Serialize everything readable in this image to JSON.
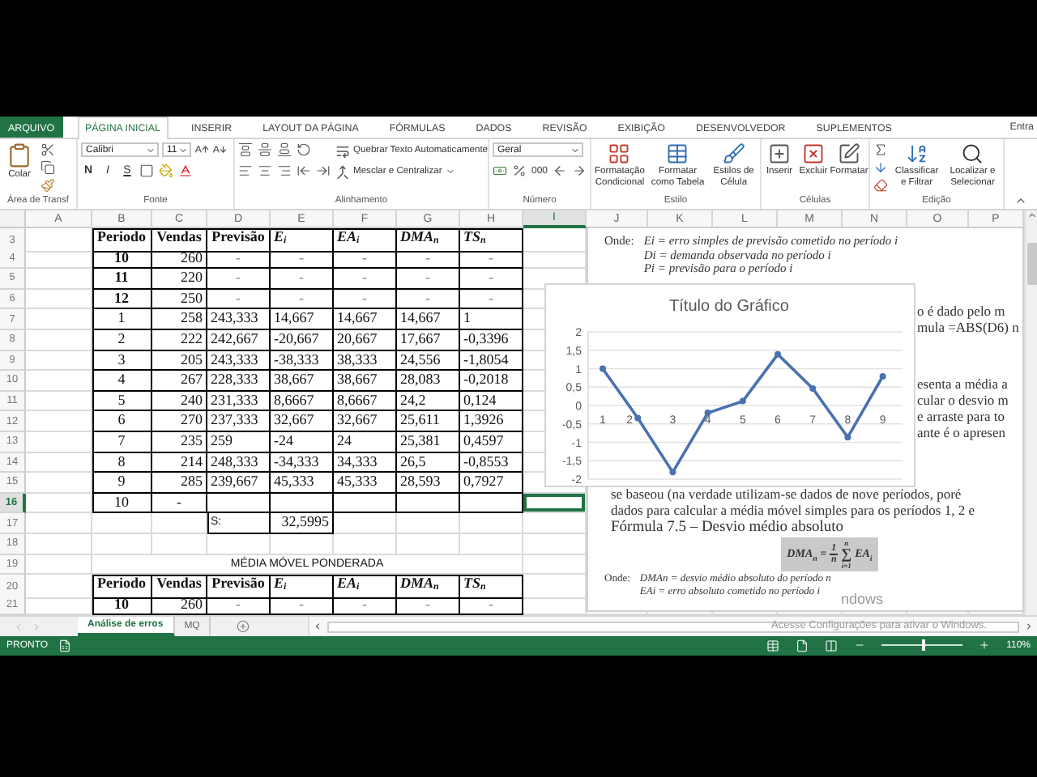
{
  "ribbon": {
    "tabs": [
      {
        "label": "ARQUIVO",
        "kind": "file",
        "selected": false
      },
      {
        "label": "PÁGINA INICIAL",
        "kind": "tab",
        "selected": true
      },
      {
        "label": "INSERIR",
        "kind": "tab",
        "selected": false
      },
      {
        "label": "LAYOUT DA PÁGINA",
        "kind": "tab",
        "selected": false
      },
      {
        "label": "FÓRMULAS",
        "kind": "tab",
        "selected": false
      },
      {
        "label": "DADOS",
        "kind": "tab",
        "selected": false
      },
      {
        "label": "REVISÃO",
        "kind": "tab",
        "selected": false
      },
      {
        "label": "EXIBIÇÃO",
        "kind": "tab",
        "selected": false
      },
      {
        "label": "DESENVOLVEDOR",
        "kind": "tab",
        "selected": false
      },
      {
        "label": "SUPLEMENTOS",
        "kind": "tab",
        "selected": false
      }
    ],
    "account": "Entra",
    "groups": [
      {
        "kind": "clipboard",
        "label": "Área de Transf",
        "buttons": [
          "Colar"
        ]
      },
      {
        "kind": "font",
        "label": "Fonte",
        "font": "Calibri",
        "size": "11",
        "styles": [
          "N",
          "I",
          "S"
        ]
      },
      {
        "kind": "alignment",
        "label": "Alinhamento",
        "buttons": [
          "Quebrar Texto Automaticamente",
          "Mesclar e Centralizar"
        ]
      },
      {
        "kind": "number",
        "label": "Número",
        "format": "Geral",
        "thousands": "000"
      },
      {
        "kind": "styles",
        "label": "Estilo",
        "buttons": [
          "Formatação Condicional",
          "Formatar como Tabela",
          "Estilos de Célula"
        ]
      },
      {
        "kind": "cells",
        "label": "Células",
        "buttons": [
          "Inserir",
          "Excluir",
          "Formatar"
        ]
      },
      {
        "kind": "editing",
        "label": "Edição",
        "buttons": [
          "Classificar e Filtrar",
          "Localizar e Selecionar"
        ]
      }
    ]
  },
  "sheet": {
    "columns": [
      {
        "label": "A",
        "selected": false
      },
      {
        "label": "B",
        "selected": false
      },
      {
        "label": "C",
        "selected": false
      },
      {
        "label": "D",
        "selected": false
      },
      {
        "label": "E",
        "selected": false
      },
      {
        "label": "F",
        "selected": false
      },
      {
        "label": "G",
        "selected": false
      },
      {
        "label": "H",
        "selected": false
      },
      {
        "label": "I",
        "selected": true
      },
      {
        "label": "J",
        "selected": false
      },
      {
        "label": "K",
        "selected": false
      },
      {
        "label": "L",
        "selected": false
      },
      {
        "label": "M",
        "selected": false
      },
      {
        "label": "N",
        "selected": false
      },
      {
        "label": "O",
        "selected": false
      },
      {
        "label": "P",
        "selected": false
      }
    ],
    "rows": [
      {
        "number": "3",
        "selected": false,
        "kind": "header",
        "cells": {
          "period": "Periodo",
          "sales": "Vendas",
          "forecast": "Previsão",
          "error": "E$_{i}$",
          "abs_error": "EA$_{i}$",
          "mad": "DMA$_{n}$",
          "ts": "TS$_{n}$"
        }
      },
      {
        "number": "4",
        "selected": false,
        "kind": "base",
        "cells": {
          "period": "10",
          "sales": "260",
          "forecast": "-",
          "error": "-",
          "abs_error": "-",
          "mad": "-",
          "ts": "-"
        }
      },
      {
        "number": "5",
        "selected": false,
        "kind": "base",
        "cells": {
          "period": "11",
          "sales": "220",
          "forecast": "-",
          "error": "-",
          "abs_error": "-",
          "mad": "-",
          "ts": "-"
        }
      },
      {
        "number": "6",
        "selected": false,
        "kind": "base",
        "cells": {
          "period": "12",
          "sales": "250",
          "forecast": "-",
          "error": "-",
          "abs_error": "-",
          "mad": "-",
          "ts": "-"
        }
      },
      {
        "number": "7",
        "selected": false,
        "kind": "data",
        "cells": {
          "period": "1",
          "sales": "258",
          "forecast": "243,333",
          "error": "14,667",
          "abs_error": "14,667",
          "mad": "14,667",
          "ts": "1"
        }
      },
      {
        "number": "8",
        "selected": false,
        "kind": "data",
        "cells": {
          "period": "2",
          "sales": "222",
          "forecast": "242,667",
          "error": "-20,667",
          "abs_error": "20,667",
          "mad": "17,667",
          "ts": "-0,3396"
        }
      },
      {
        "number": "9",
        "selected": false,
        "kind": "data",
        "cells": {
          "period": "3",
          "sales": "205",
          "forecast": "243,333",
          "error": "-38,333",
          "abs_error": "38,333",
          "mad": "24,556",
          "ts": "-1,8054"
        }
      },
      {
        "number": "10",
        "selected": false,
        "kind": "data",
        "cells": {
          "period": "4",
          "sales": "267",
          "forecast": "228,333",
          "error": "38,667",
          "abs_error": "38,667",
          "mad": "28,083",
          "ts": "-0,2018"
        }
      },
      {
        "number": "11",
        "selected": false,
        "kind": "data",
        "cells": {
          "period": "5",
          "sales": "240",
          "forecast": "231,333",
          "error": "8,6667",
          "abs_error": "8,6667",
          "mad": "24,2",
          "ts": "0,124"
        }
      },
      {
        "number": "12",
        "selected": false,
        "kind": "data",
        "cells": {
          "period": "6",
          "sales": "270",
          "forecast": "237,333",
          "error": "32,667",
          "abs_error": "32,667",
          "mad": "25,611",
          "ts": "1,3926"
        }
      },
      {
        "number": "13",
        "selected": false,
        "kind": "data",
        "cells": {
          "period": "7",
          "sales": "235",
          "forecast": "259",
          "error": "-24",
          "abs_error": "24",
          "mad": "25,381",
          "ts": "0,4597"
        }
      },
      {
        "number": "14",
        "selected": false,
        "kind": "data",
        "cells": {
          "period": "8",
          "sales": "214",
          "forecast": "248,333",
          "error": "-34,333",
          "abs_error": "34,333",
          "mad": "26,5",
          "ts": "-0,8553"
        }
      },
      {
        "number": "15",
        "selected": false,
        "kind": "data",
        "cells": {
          "period": "9",
          "sales": "285",
          "forecast": "239,667",
          "error": "45,333",
          "abs_error": "45,333",
          "mad": "28,593",
          "ts": "0,7927"
        }
      },
      {
        "number": "16",
        "selected": true,
        "kind": "open",
        "cells": {
          "period": "10",
          "sales": "-"
        }
      },
      {
        "number": "17",
        "selected": false,
        "kind": "sum",
        "cells": {
          "forecast": "S:",
          "error": "32,5995"
        }
      },
      {
        "number": "18",
        "selected": false,
        "kind": "empty"
      },
      {
        "number": "19",
        "selected": false,
        "kind": "title",
        "cells": {
          "title": "MÉDIA MÓVEL PONDERADA"
        }
      },
      {
        "number": "20",
        "selected": false,
        "kind": "header",
        "cells": {
          "period": "Periodo",
          "sales": "Vendas",
          "forecast": "Previsão",
          "error": "E$_{i}$",
          "abs_error": "EA$_{i}$",
          "mad": "DMA$_{n}$",
          "ts": "TS$_{n}$"
        }
      },
      {
        "number": "21",
        "selected": false,
        "kind": "base",
        "cells": {
          "period": "10",
          "sales": "260",
          "forecast": "-",
          "error": "-",
          "abs_error": "-",
          "mad": "-",
          "ts": "-"
        }
      }
    ]
  },
  "pasted_image": {
    "legend_top": {
      "label": "Onde:",
      "items": [
        "Ei = erro simples de previsão cometido no período i",
        "Di = demanda observada no período i",
        "Pi = previsão para o período i"
      ]
    },
    "fragments_top": [
      "o é dado pelo m",
      "mula =ABS(D6) n"
    ],
    "fragments_middle": [
      "esenta a média a",
      "cular o desvio m",
      "e arraste para to",
      "ante é o apresen"
    ],
    "paragraph": [
      "se baseou (na verdade utilizam-se dados de nove períodos, poré",
      "dados para calcular a média móvel simples para os períodos 1, 2 e"
    ],
    "formula_title": "Fórmula 7.5 – Desvio médio absoluto",
    "formula": {
      "lhs": "DMA$_{n}$ =",
      "numerator": "1",
      "denominator": "n",
      "operator": "∑",
      "upper": "n",
      "lower": "i=1",
      "term": "EA$_{i}$"
    },
    "legend_bottom": {
      "label": "Onde:",
      "items": [
        "DMAn = desvio médio absoluto do período n",
        "EAi = erro absoluto cometido no período i"
      ]
    }
  },
  "chart": {
    "chart_data": {
      "type": "line",
      "title": "Título do Gráfico",
      "categories": [
        "1",
        "2",
        "3",
        "4",
        "5",
        "6",
        "7",
        "8",
        "9"
      ],
      "series": [
        {
          "color": "#4a72b0",
          "marker": "circle",
          "values": [
            1,
            -0.34,
            -1.81,
            -0.2,
            0.12,
            1.39,
            0.46,
            -0.86,
            0.79
          ]
        }
      ],
      "grid": true,
      "ylim": [
        -2,
        2
      ],
      "yticks": [
        {
          "value": -2,
          "label": "-2"
        },
        {
          "value": -1.5,
          "label": "-1,5"
        },
        {
          "value": -1,
          "label": "-1"
        },
        {
          "value": -0.5,
          "label": "-0,5"
        },
        {
          "value": 0,
          "label": "0"
        },
        {
          "value": 0.5,
          "label": "0,5"
        },
        {
          "value": 1,
          "label": "1"
        },
        {
          "value": 1.5,
          "label": "1,5"
        },
        {
          "value": 2,
          "label": "2"
        }
      ]
    }
  },
  "sheet_tabs": [
    {
      "label": "Análise de erros",
      "selected": true
    },
    {
      "label": "MQ",
      "selected": false
    }
  ],
  "os_notice": {
    "fragment": "ndows",
    "text": "Acesse Configurações para ativar o Windows."
  },
  "status_bar": {
    "status": "PRONTO",
    "zoom": {
      "level": 0.52,
      "reading": "110%"
    }
  }
}
